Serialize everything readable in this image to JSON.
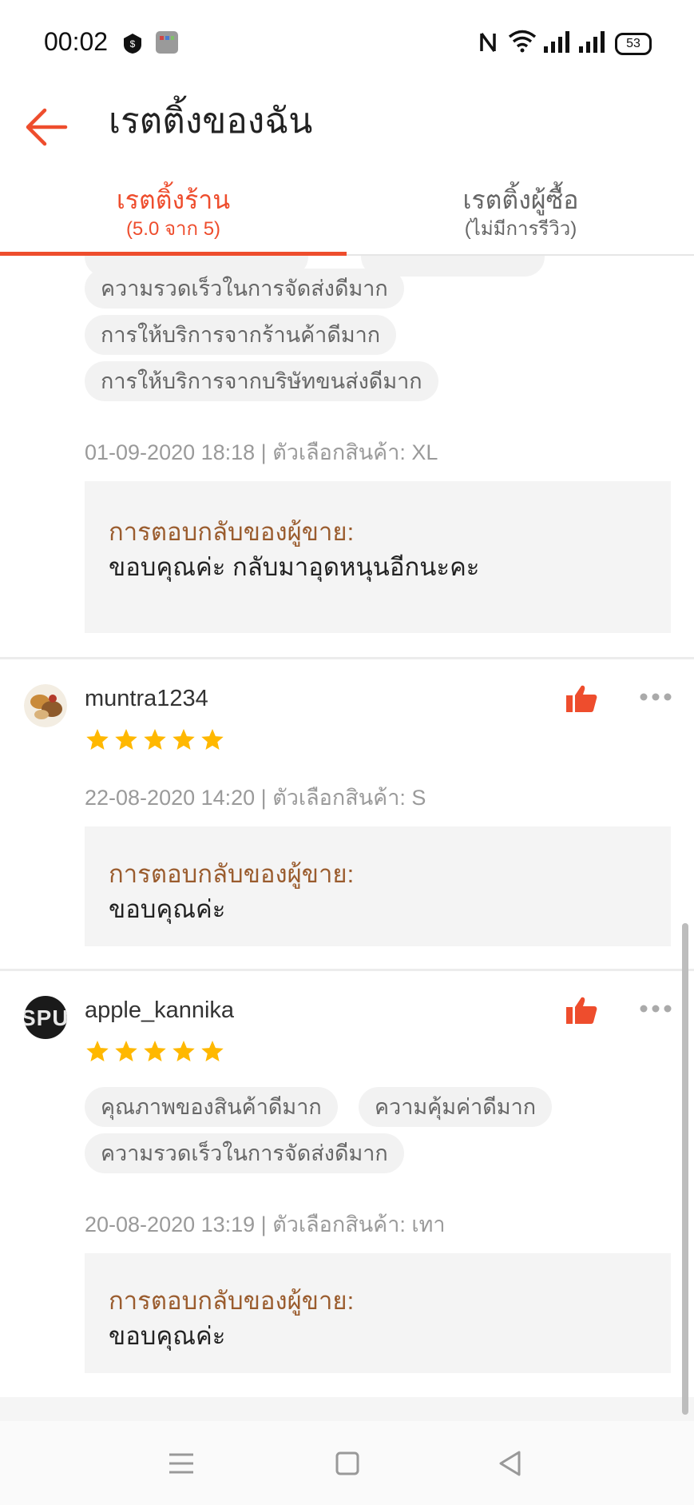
{
  "status": {
    "time": "00:02",
    "battery": "53"
  },
  "header": {
    "title": "เรตติ้งของฉัน"
  },
  "tabs": [
    {
      "title": "เรตติ้งร้าน",
      "sub": "(5.0 จาก 5)"
    },
    {
      "title": "เรตติ้งผู้ซื้อ",
      "sub": "(ไม่มีการรีวิว)"
    }
  ],
  "review1": {
    "tags": [
      "ความรวดเร็วในการจัดส่งดีมาก",
      "การให้บริการจากร้านค้าดีมาก",
      "การให้บริการจากบริษัทขนส่งดีมาก"
    ],
    "meta": "01-09-2020 18:18 | ตัวเลือกสินค้า: XL",
    "reply_label": "การตอบกลับของผู้ขาย:",
    "reply_text": "ขอบคุณค่ะ กลับมาอุดหนุนอีกนะคะ"
  },
  "review2": {
    "username": "muntra1234",
    "stars": 5,
    "meta": "22-08-2020 14:20 | ตัวเลือกสินค้า: S",
    "reply_label": "การตอบกลับของผู้ขาย:",
    "reply_text": "ขอบคุณค่ะ"
  },
  "review3": {
    "username": "apple_kannika",
    "avatar_text": "SPU",
    "stars": 5,
    "tags": [
      "คุณภาพของสินค้าดีมาก",
      "ความคุ้มค่าดีมาก",
      "ความรวดเร็วในการจัดส่งดีมาก"
    ],
    "meta": "20-08-2020 13:19 | ตัวเลือกสินค้า: เทา",
    "reply_label": "การตอบกลับของผู้ขาย:",
    "reply_text": "ขอบคุณค่ะ"
  },
  "colors": {
    "accent": "#ee4d2d",
    "star": "#ffb800",
    "reply_label": "#9a5c2e"
  },
  "icons": [
    "back-arrow-icon",
    "thumbs-up-icon",
    "more-options-icon",
    "star-icon",
    "menu-icon",
    "home-icon",
    "back-icon"
  ]
}
